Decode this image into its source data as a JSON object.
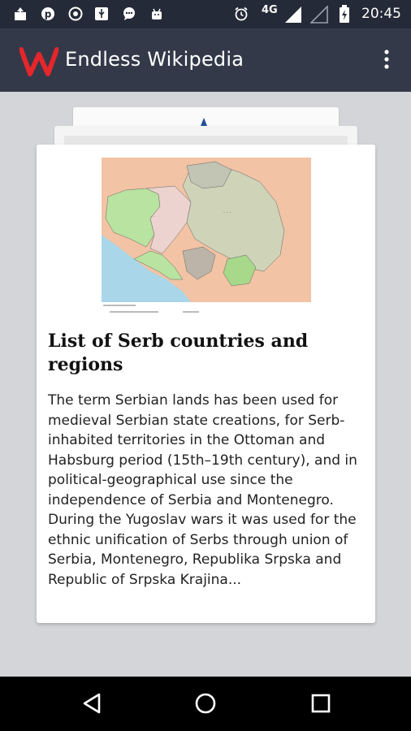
{
  "status_bar": {
    "time": "20:45",
    "network_label": "4G",
    "icons": [
      "upload-icon",
      "pinterest-icon",
      "vpn-icon",
      "usb-icon",
      "chat-icon",
      "android-icon",
      "alarm-icon",
      "signal-icon",
      "signal-empty-icon",
      "battery-icon"
    ]
  },
  "app_bar": {
    "title": "Endless Wikipedia",
    "logo_color": "#e5262b",
    "menu_icon": "overflow-menu-icon"
  },
  "card": {
    "title": "List of Serb countries and regions",
    "extract": "The term Serbian lands has been used for medieval Serbian state creations, for Serb-inhabited territories in the Ottoman and Habsburg period (15th–19th century), and in political-geographical use since the independence of Serbia and Montenegro. During the Yugoslav wars it was used for the ethnic unification of Serbs through union of Serbia, Montenegro, Republika Srpska and Republic of Srpska Krajina...",
    "image": "map-image"
  },
  "nav_bar": {
    "buttons": [
      "back-icon",
      "home-icon",
      "recents-icon"
    ]
  },
  "colors": {
    "app_bar": "#333949",
    "status_bar": "#252a38",
    "background": "#d3d5d8"
  }
}
